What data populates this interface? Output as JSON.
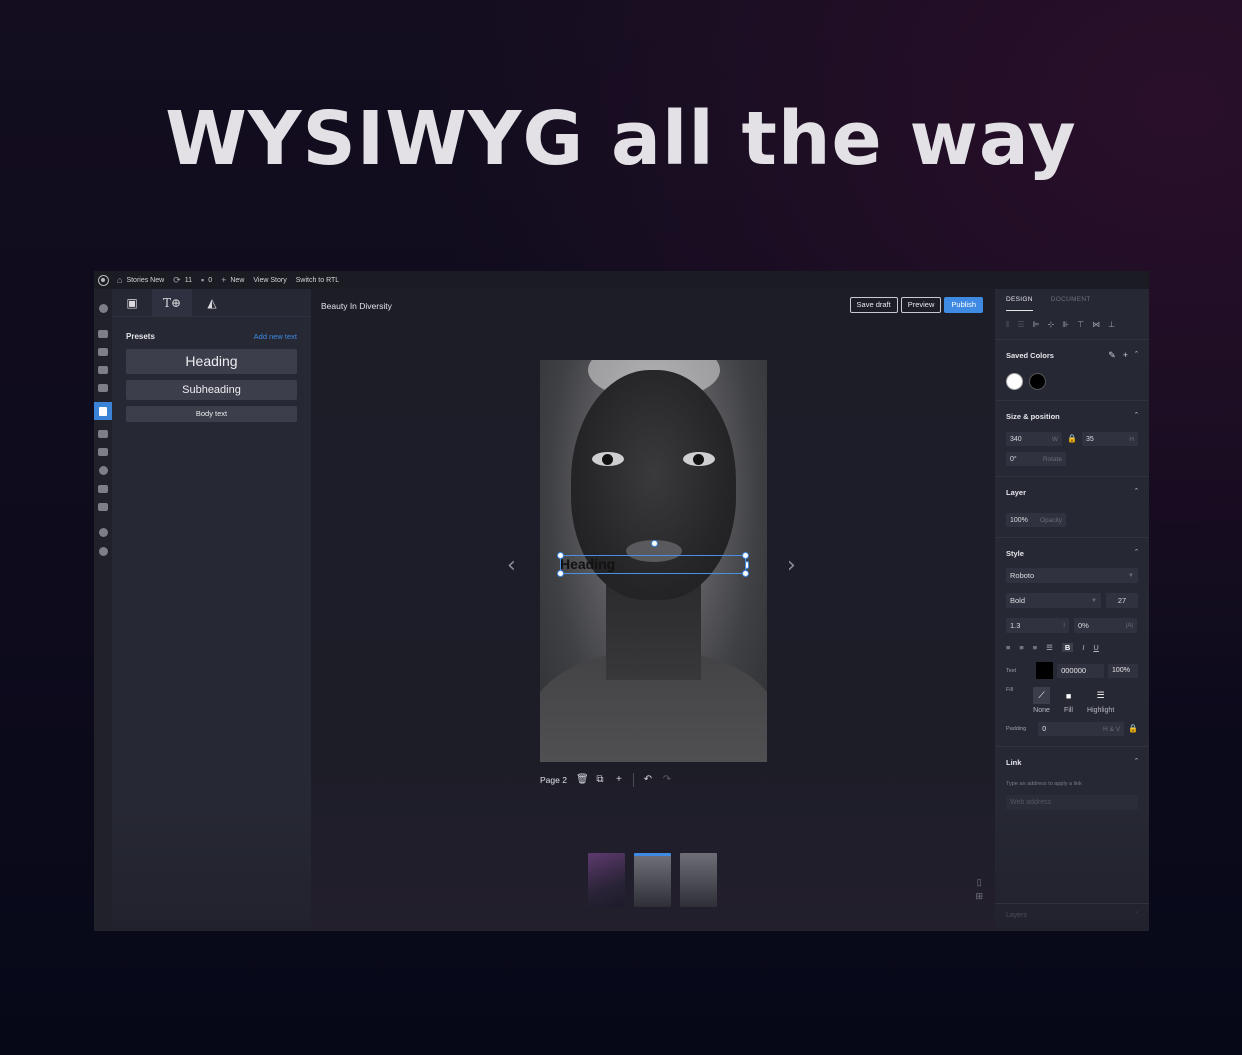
{
  "hero_title": "WYSIWYG all the way",
  "adminbar": {
    "site": "Stories New",
    "updates": "11",
    "comments": "0",
    "new": "New",
    "view": "View Story",
    "rtl": "Switch to RTL"
  },
  "library": {
    "presets_title": "Presets",
    "add_new_text": "Add new text",
    "presets": {
      "heading": "Heading",
      "subheading": "Subheading",
      "body": "Body text"
    }
  },
  "editor": {
    "story_title": "Beauty In Diversity",
    "save_draft": "Save draft",
    "preview": "Preview",
    "publish": "Publish",
    "selected_text": "Heading",
    "page_label": "Page 2"
  },
  "inspector": {
    "tabs": {
      "design": "DESIGN",
      "document": "DOCUMENT"
    },
    "saved_colors": "Saved Colors",
    "swatches": [
      "#ffffff",
      "#000000"
    ],
    "size_position": {
      "title": "Size & position",
      "width": "340",
      "width_label": "W",
      "height": "35",
      "height_label": "H",
      "rotate": "0°",
      "rotate_label": "Rotate"
    },
    "layer": {
      "title": "Layer",
      "opacity": "100%",
      "opacity_label": "Opacity"
    },
    "style": {
      "title": "Style",
      "font": "Roboto",
      "weight": "Bold",
      "size": "27",
      "line_height": "1.3",
      "letter_spacing": "0%",
      "text_label": "Text",
      "text_color": "000000",
      "text_opacity": "100%",
      "fill_label": "Fill",
      "fill_options": [
        "None",
        "Fill",
        "Highlight"
      ],
      "padding_label": "Padding",
      "padding_value": "0",
      "padding_mode": "H & V"
    },
    "link": {
      "title": "Link",
      "hint": "Type an address to apply a link",
      "placeholder": "Web address"
    },
    "layers": "Layers"
  },
  "colors": {
    "accent": "#3f8ae3",
    "panel": "#262834",
    "workspace": "#1c1d27"
  }
}
